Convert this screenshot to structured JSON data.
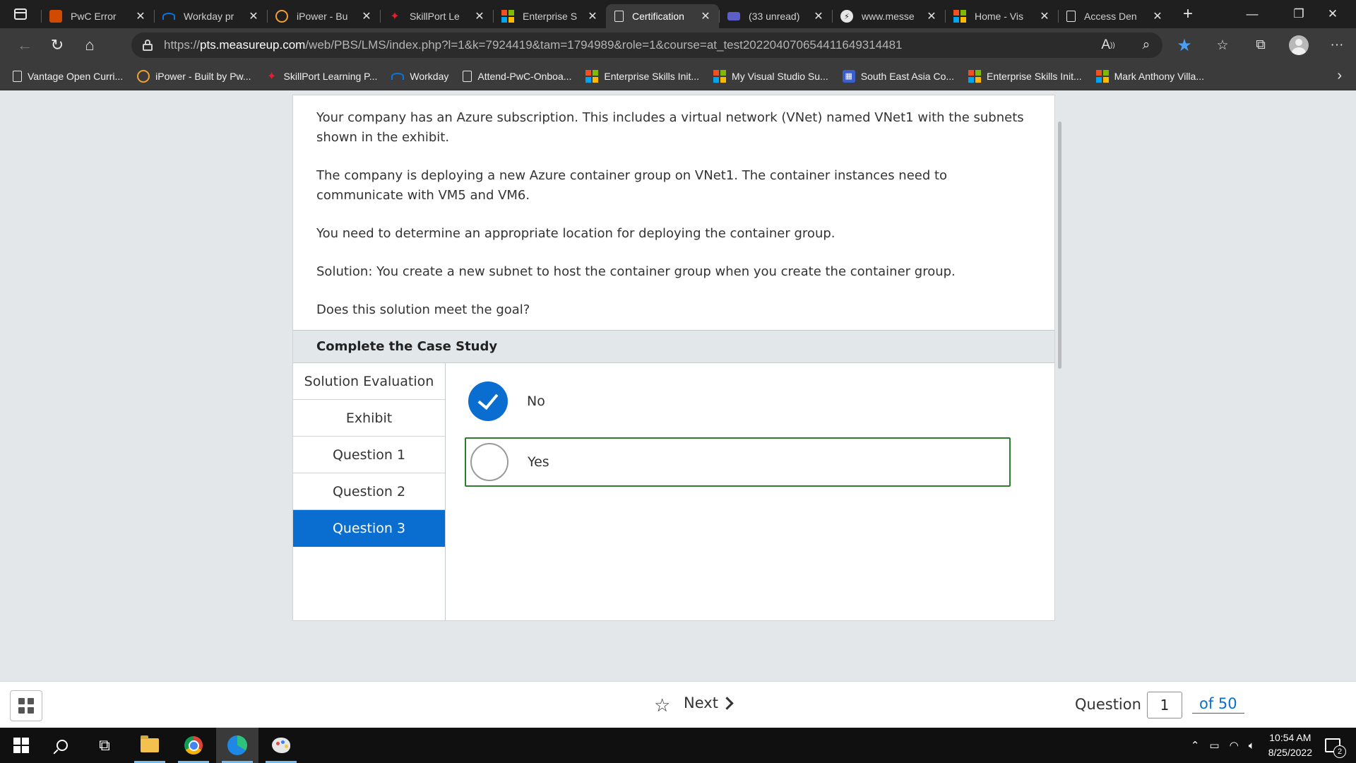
{
  "browser": {
    "tabs": [
      {
        "title": "PwC Error",
        "favicon": "pwc-icon",
        "color": "#d04a02",
        "active": false
      },
      {
        "title": "Workday pr",
        "favicon": "workday-icon",
        "color": "#0875e1",
        "active": false
      },
      {
        "title": "iPower - Bu",
        "favicon": "ipower-icon",
        "color": "#f0a030",
        "active": false
      },
      {
        "title": "SkillPort Le",
        "favicon": "skillport-icon",
        "color": "#e02030",
        "active": false
      },
      {
        "title": "Enterprise S",
        "favicon": "microsoft-icon",
        "color": "#f25022",
        "active": false
      },
      {
        "title": "Certification",
        "favicon": "document-icon",
        "color": "#e6e6e6",
        "active": true
      },
      {
        "title": "(33 unread)",
        "favicon": "mail-icon",
        "color": "#5b5fc7",
        "active": false
      },
      {
        "title": "www.messe",
        "favicon": "messenger-icon",
        "color": "#ffffff",
        "active": false
      },
      {
        "title": "Home - Vis",
        "favicon": "microsoft-icon",
        "color": "#f25022",
        "active": false
      },
      {
        "title": "Access Den",
        "favicon": "document-icon",
        "color": "#e6e6e6",
        "active": false
      }
    ],
    "url_prefix": "https://",
    "url_domain": "pts.measureup.com",
    "url_path": "/web/PBS/LMS/index.php?l=1&k=7924419&tam=1794989&role=1&course=at_test20220407065441164931448​1",
    "bookmarks": [
      {
        "label": "Vantage Open Curri...",
        "icon": "document-icon"
      },
      {
        "label": "iPower - Built by Pw...",
        "icon": "ipower-icon"
      },
      {
        "label": "SkillPort Learning P...",
        "icon": "skillport-icon"
      },
      {
        "label": "Workday",
        "icon": "workday-icon"
      },
      {
        "label": "Attend-PwC-Onboa...",
        "icon": "document-icon"
      },
      {
        "label": "Enterprise Skills Init...",
        "icon": "microsoft-icon"
      },
      {
        "label": "My Visual Studio Su...",
        "icon": "microsoft-icon"
      },
      {
        "label": "South East Asia Co...",
        "icon": "calendar-icon"
      },
      {
        "label": "Enterprise Skills Init...",
        "icon": "microsoft-icon"
      },
      {
        "label": "Mark Anthony Villa...",
        "icon": "microsoft-icon"
      }
    ]
  },
  "question": {
    "paragraphs": [
      "Your company has an Azure subscription. This includes a virtual network (VNet) named VNet1 with the subnets shown in the exhibit.",
      "The company is deploying a new Azure container group on VNet1. The container instances need to communicate with VM5 and VM6.",
      "You need to determine an appropriate location for deploying the container group.",
      "Solution: You create a new subnet to host the container group when you create the container group.",
      "Does this solution meet the goal?"
    ],
    "case_header": "Complete the Case Study",
    "side_nav": [
      {
        "label": "Solution Evaluation",
        "active": false
      },
      {
        "label": "Exhibit",
        "active": false
      },
      {
        "label": "Question 1",
        "active": false
      },
      {
        "label": "Question 2",
        "active": false
      },
      {
        "label": "Question 3",
        "active": true
      }
    ],
    "options": [
      {
        "label": "No",
        "checked": true
      },
      {
        "label": "Yes",
        "checked": false
      }
    ]
  },
  "footer": {
    "next_label": "Next",
    "question_label": "Question",
    "question_number": "1",
    "of_label": "of 50"
  },
  "taskbar": {
    "time": "10:54 AM",
    "date": "8/25/2022",
    "notification_count": "2"
  },
  "colors": {
    "accent": "#0a6ed1",
    "focus_border": "#2f7d2f"
  }
}
